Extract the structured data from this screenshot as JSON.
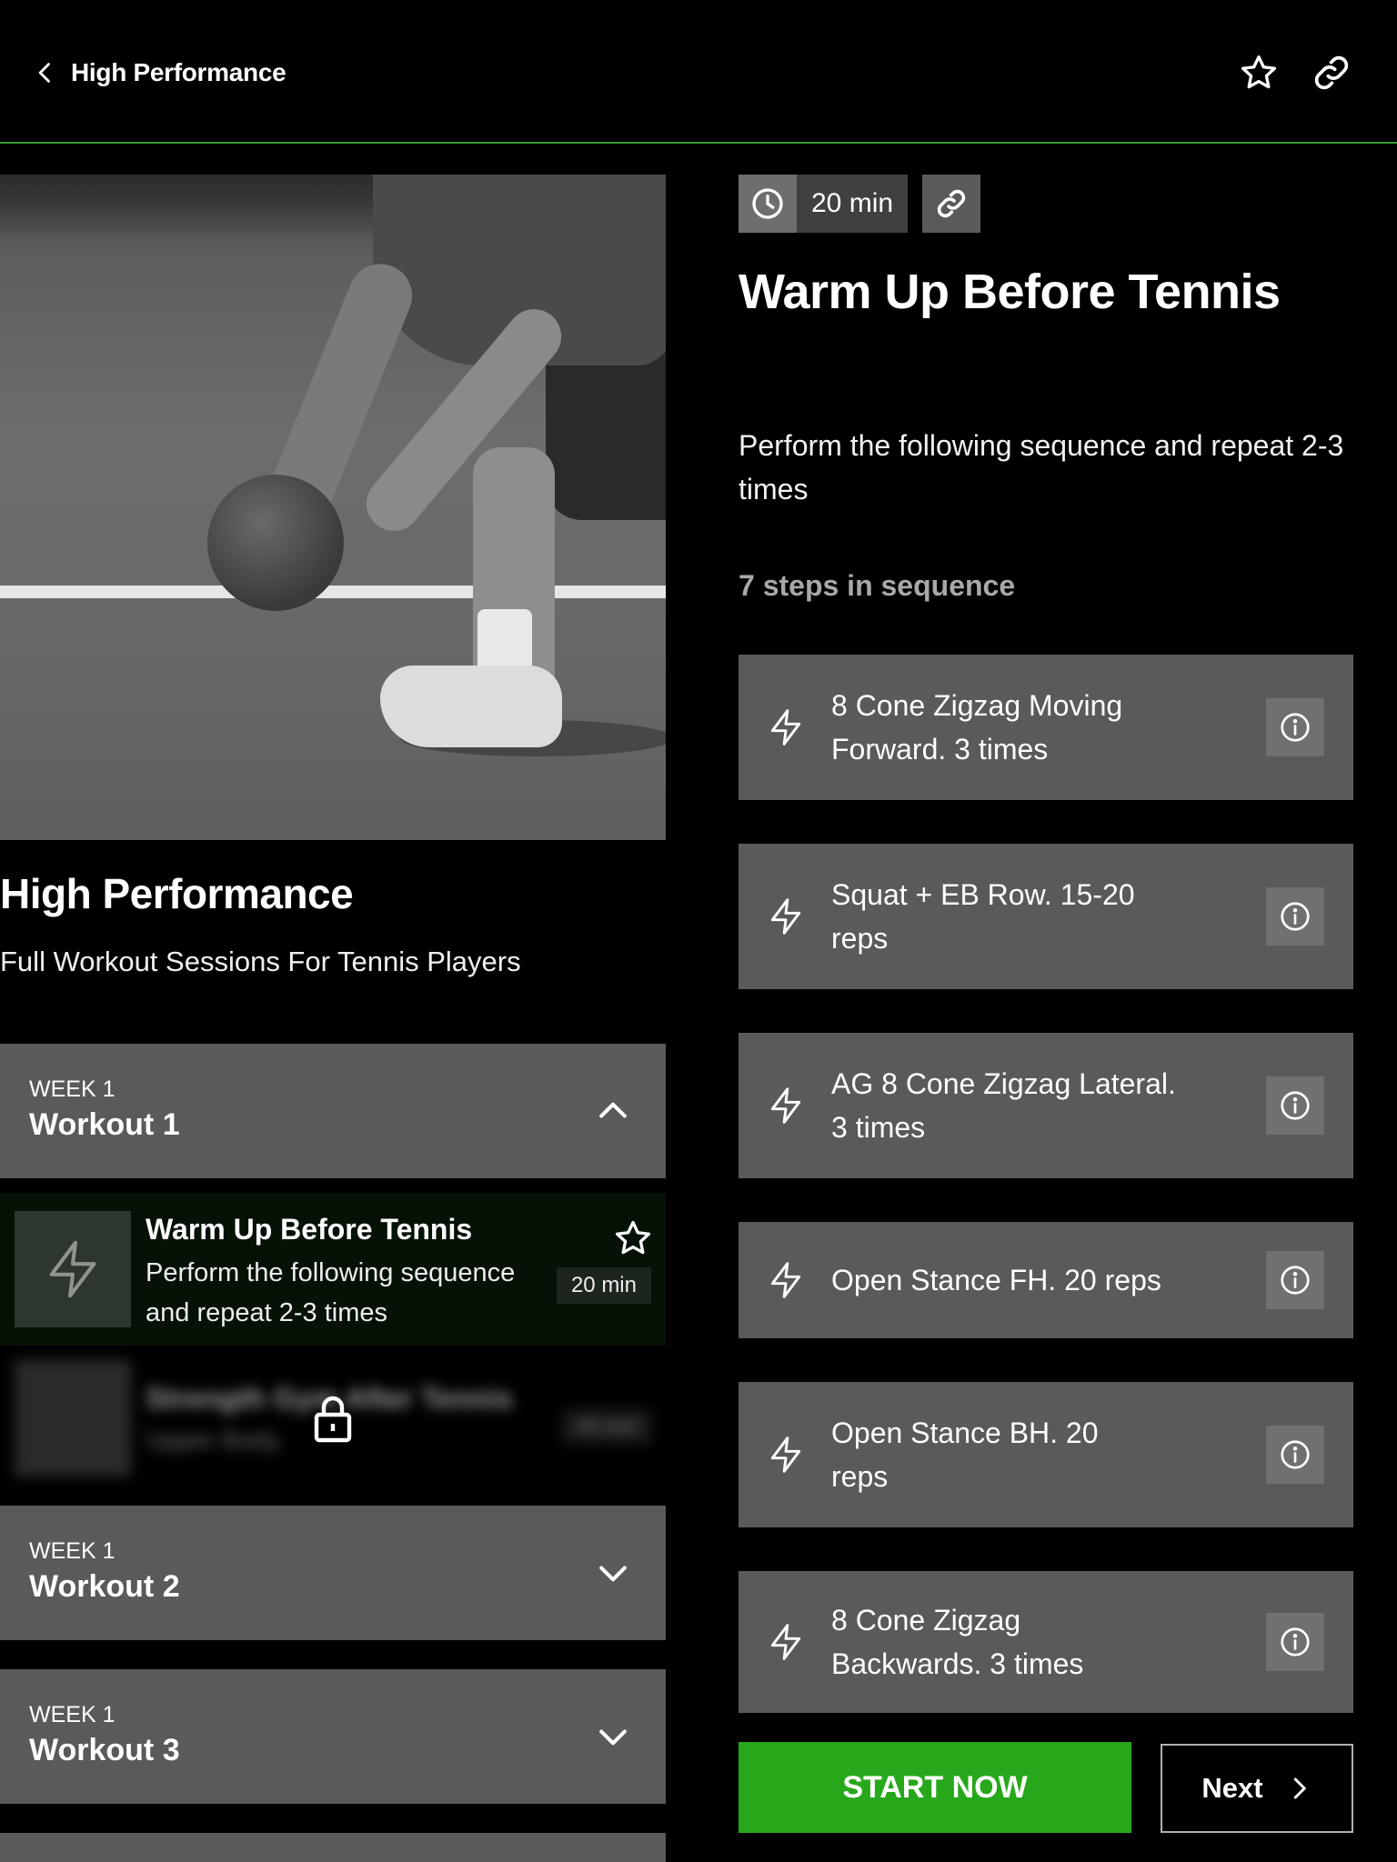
{
  "header": {
    "back_label": "High Performance",
    "icons": {
      "back": "chevron-left-icon",
      "favorite": "star-icon",
      "share": "link-icon"
    },
    "accent_line_color": "#2f9a2a"
  },
  "program": {
    "title": "High Performance",
    "subtitle": "Full Workout Sessions For Tennis Players",
    "hero_image": "tennis player kneeling holding medicine ball on court (black and white)"
  },
  "weeks": [
    {
      "week_label": "WEEK 1",
      "name": "Workout 1",
      "expanded": true
    },
    {
      "week_label": "WEEK 1",
      "name": "Workout 2",
      "expanded": false
    },
    {
      "week_label": "WEEK 1",
      "name": "Workout 3",
      "expanded": false
    }
  ],
  "sessions": [
    {
      "title": "Warm Up Before Tennis",
      "description": "Perform the following sequence and repeat 2-3 times",
      "duration": "20 min",
      "selected": true,
      "locked": false
    },
    {
      "title": "Strength Gym After Tennis",
      "description": "Upper Body",
      "duration": "45 min",
      "selected": false,
      "locked": true
    }
  ],
  "workout": {
    "duration": "20 min",
    "title": "Warm Up Before Tennis",
    "description": "Perform the following sequence and repeat 2-3 times",
    "steps_count_label": "7 steps in sequence",
    "steps": [
      {
        "label": "8 Cone Zigzag Moving Forward. 3 times"
      },
      {
        "label": "Squat + EB Row. 15-20 reps"
      },
      {
        "label": "AG 8 Cone Zigzag Lateral. 3 times"
      },
      {
        "label": "Open Stance FH. 20 reps"
      },
      {
        "label": "Open Stance BH. 20 reps"
      },
      {
        "label": "8 Cone Zigzag Backwards. 3 times"
      }
    ]
  },
  "actions": {
    "start_label": "START NOW",
    "next_label": "Next",
    "start_color": "#27a81b"
  }
}
